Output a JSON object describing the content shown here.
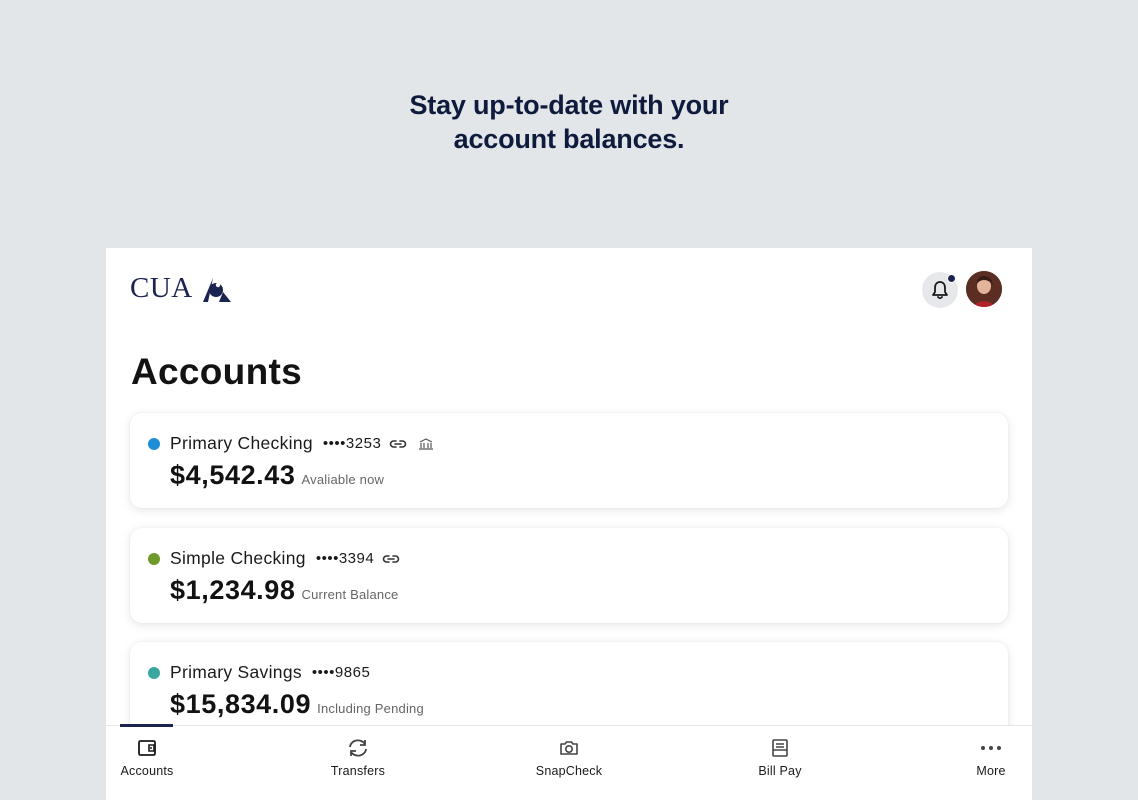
{
  "headline": {
    "line1": "Stay up-to-date with your",
    "line2": "account balances."
  },
  "header": {
    "logo_text": "CUA",
    "has_notification": true
  },
  "page_title": "Accounts",
  "accounts": [
    {
      "name": "Primary Checking",
      "mask": "••••3253",
      "amount": "$4,542.43",
      "amount_label": "Avaliable now",
      "dot_color": "#1e8fd6",
      "icons": [
        "link-icon",
        "bank-transfer-icon"
      ]
    },
    {
      "name": "Simple Checking",
      "mask": "••••3394",
      "amount": "$1,234.98",
      "amount_label": "Current Balance",
      "dot_color": "#6f9a2a",
      "icons": [
        "link-icon"
      ]
    },
    {
      "name": "Primary Savings",
      "mask": "••••9865",
      "amount": "$15,834.09",
      "amount_label": "Including Pending",
      "dot_color": "#3aa6a0",
      "icons": []
    }
  ],
  "nav": {
    "active": "Accounts",
    "items": [
      {
        "label": "Accounts",
        "icon": "wallet-icon"
      },
      {
        "label": "Transfers",
        "icon": "transfer-icon"
      },
      {
        "label": "SnapCheck",
        "icon": "camera-icon"
      },
      {
        "label": "Bill Pay",
        "icon": "bill-icon"
      },
      {
        "label": "More",
        "icon": "more-icon"
      }
    ]
  },
  "colors": {
    "background": "#e2e6e9",
    "brand_navy": "#1b2450",
    "headline": "#0f1b3d"
  }
}
